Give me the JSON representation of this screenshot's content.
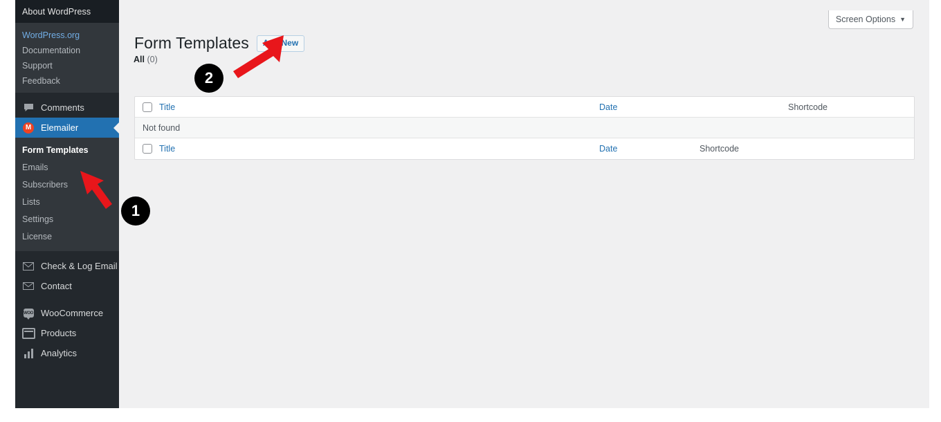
{
  "sidebar": {
    "about_label": "About WordPress",
    "links": [
      {
        "label": "WordPress.org",
        "style": "blue"
      },
      {
        "label": "Documentation",
        "style": "plain"
      },
      {
        "label": "Support",
        "style": "plain"
      },
      {
        "label": "Feedback",
        "style": "plain"
      }
    ],
    "items": [
      {
        "label": "Comments",
        "icon": "comment-icon"
      },
      {
        "label": "Elemailer",
        "icon": "elemailer-icon",
        "current": true
      },
      {
        "label": "Check & Log Email",
        "icon": "envelope-open-icon"
      },
      {
        "label": "Contact",
        "icon": "envelope-icon"
      },
      {
        "label": "WooCommerce",
        "icon": "woocommerce-icon"
      },
      {
        "label": "Products",
        "icon": "products-icon"
      },
      {
        "label": "Analytics",
        "icon": "analytics-bars-icon"
      }
    ],
    "submenu": [
      {
        "label": "Form Templates",
        "active": true
      },
      {
        "label": "Emails",
        "active": false
      },
      {
        "label": "Subscribers",
        "active": false
      },
      {
        "label": "Lists",
        "active": false
      },
      {
        "label": "Settings",
        "active": false
      },
      {
        "label": "License",
        "active": false
      }
    ]
  },
  "screen_options": {
    "label": "Screen Options",
    "caret": "▼"
  },
  "page": {
    "title": "Form Templates",
    "add_new_label": "Add New",
    "filter_all_label": "All",
    "filter_all_count": "(0)"
  },
  "table": {
    "header": {
      "title": "Title",
      "date": "Date",
      "shortcode": "Shortcode"
    },
    "empty_message": "Not found",
    "footer": {
      "title": "Title",
      "date": "Date",
      "shortcode": "Shortcode"
    }
  },
  "annotations": {
    "markers": [
      {
        "number": "1"
      },
      {
        "number": "2"
      }
    ]
  },
  "colors": {
    "accent_blue": "#2271b1",
    "sidebar_bg": "#23282d",
    "submenu_bg": "#32373c",
    "brand_red": "#ef4323",
    "annotation_red": "#e8161b"
  }
}
